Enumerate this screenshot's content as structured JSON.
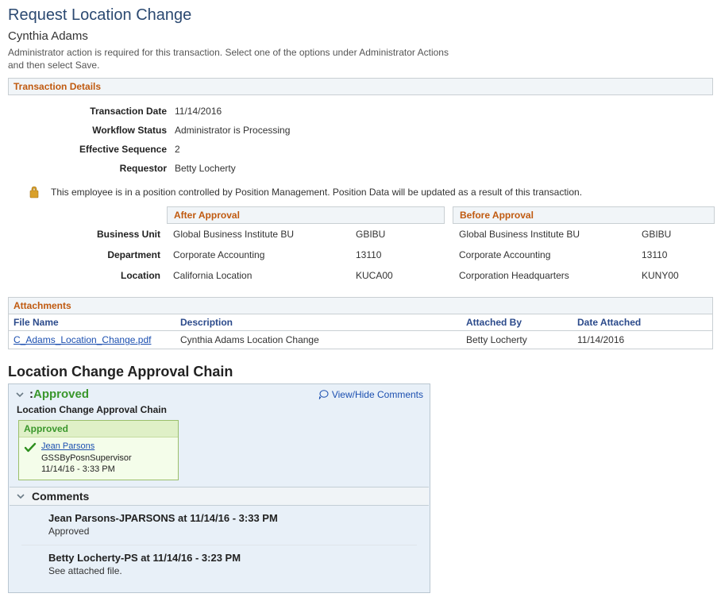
{
  "page_title": "Request Location Change",
  "employee_name": "Cynthia Adams",
  "instruction": "Administrator action is required for this transaction. Select one of the options under Administrator Actions and then select Save.",
  "transaction_section_title": "Transaction Details",
  "transaction": {
    "labels": {
      "date": "Transaction Date",
      "workflow": "Workflow Status",
      "sequence": "Effective Sequence",
      "requestor": "Requestor"
    },
    "date": "11/14/2016",
    "workflow": "Administrator is Processing",
    "sequence": "2",
    "requestor": "Betty Locherty"
  },
  "position_note": "This employee is in a position controlled by Position Management. Position Data will be updated as a result of this transaction.",
  "compare": {
    "after_title": "After Approval",
    "before_title": "Before Approval",
    "row_labels": {
      "bu": "Business Unit",
      "dept": "Department",
      "loc": "Location"
    },
    "after": {
      "bu_desc": "Global Business Institute BU",
      "bu_code": "GBIBU",
      "dept_desc": "Corporate Accounting",
      "dept_code": "13110",
      "loc_desc": "California Location",
      "loc_code": "KUCA00"
    },
    "before": {
      "bu_desc": "Global Business Institute BU",
      "bu_code": "GBIBU",
      "dept_desc": "Corporate Accounting",
      "dept_code": "13110",
      "loc_desc": "Corporation Headquarters",
      "loc_code": "KUNY00"
    }
  },
  "attachments": {
    "title": "Attachments",
    "headers": {
      "file": "File Name",
      "desc": "Description",
      "by": "Attached By",
      "date": "Date Attached"
    },
    "rows": [
      {
        "file": "C_Adams_Location_Change.pdf",
        "desc": "Cynthia Adams Location Change",
        "by": "Betty Locherty",
        "date": "11/14/2016"
      }
    ]
  },
  "chain": {
    "title": "Location Change Approval Chain",
    "status_prefix": ":",
    "status": "Approved",
    "viewhide": "View/Hide Comments",
    "sub_label": "Location Change Approval Chain",
    "card": {
      "status": "Approved",
      "name": "Jean Parsons",
      "role": "GSSByPosnSupervisor",
      "timestamp": "11/14/16 - 3:33 PM"
    },
    "comments_label": "Comments",
    "comments": [
      {
        "header": "Jean Parsons-JPARSONS at 11/14/16 - 3:33 PM",
        "body": "Approved"
      },
      {
        "header": "Betty Locherty-PS at 11/14/16 - 3:23 PM",
        "body": "See attached file."
      }
    ]
  }
}
